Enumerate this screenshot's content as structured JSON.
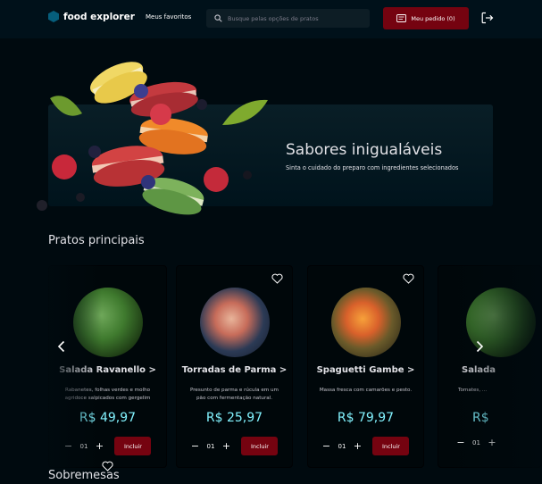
{
  "header": {
    "logo_text": "food explorer",
    "favorites_label": "Meus favoritos",
    "search_placeholder": "Busque pelas opções de pratos",
    "order_label": "Meu pedido (0)"
  },
  "banner": {
    "title": "Sabores inigualáveis",
    "subtitle": "Sinta o cuidado do preparo com ingredientes selecionados"
  },
  "sections": {
    "main_dishes": "Pratos principais",
    "desserts": "Sobremesas"
  },
  "dishes": [
    {
      "name": "Salada Ravanello >",
      "description": "Rabanetes, folhas verdes e molho agridoce salpicados com gergelim",
      "price": "R$ 49,97",
      "qty": "01",
      "add_label": "Incluir"
    },
    {
      "name": "Torradas de Parma >",
      "description": "Presunto de parma e rúcula em um pão com fermentação natural.",
      "price": "R$ 25,97",
      "qty": "01",
      "add_label": "Incluir"
    },
    {
      "name": "Spaguetti Gambe  >",
      "description": "Massa fresca com camarões e pesto.",
      "price": "R$ 79,97",
      "qty": "01",
      "add_label": "Incluir"
    },
    {
      "name": "Salada",
      "description": "Tomates, ...",
      "price": "R$",
      "qty": "01",
      "add_label": ""
    }
  ],
  "colors": {
    "accent_red": "#750310",
    "price_cyan": "#82F3FF",
    "logo_blue": "#065E7C"
  }
}
